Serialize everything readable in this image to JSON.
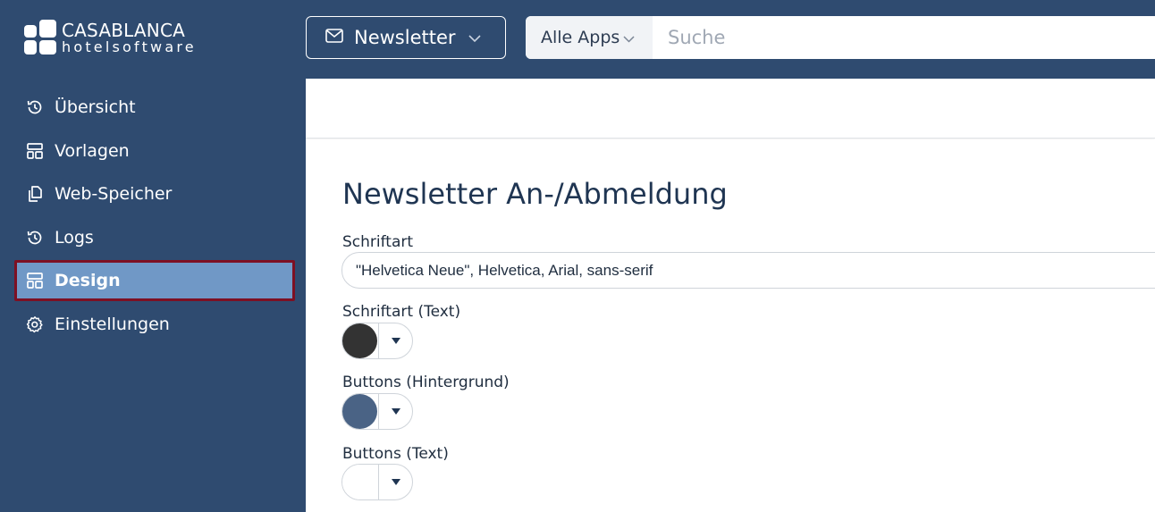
{
  "brand": {
    "name_line1": "CASABLANCA",
    "name_line2": "hotelsoftware",
    "colors": {
      "topbar": "#2f4b70",
      "sidebar": "#2f4b70",
      "active_item": "#7098c6",
      "active_outline": "#7d1023"
    }
  },
  "header": {
    "app_select": {
      "label": "Newsletter",
      "icon": "mail-icon"
    },
    "search": {
      "scope_label": "Alle Apps",
      "placeholder": "Suche",
      "value": ""
    }
  },
  "sidebar": {
    "items": [
      {
        "label": "Übersicht",
        "icon": "history-icon",
        "active": false
      },
      {
        "label": "Vorlagen",
        "icon": "layout-icon",
        "active": false
      },
      {
        "label": "Web-Speicher",
        "icon": "copy-icon",
        "active": false
      },
      {
        "label": "Logs",
        "icon": "history-icon",
        "active": false
      },
      {
        "label": "Design",
        "icon": "layout-icon",
        "active": true
      },
      {
        "label": "Einstellungen",
        "icon": "gear-icon",
        "active": false
      }
    ]
  },
  "main": {
    "title": "Newsletter An-/Abmeldung",
    "font_field": {
      "label": "Schriftart",
      "value": "\"Helvetica Neue\", Helvetica, Arial, sans-serif"
    },
    "color_fields": [
      {
        "label": "Schriftart (Text)",
        "color": "#333333"
      },
      {
        "label": "Buttons (Hintergrund)",
        "color": "#4a6385"
      },
      {
        "label": "Buttons (Text)",
        "color": "#ffffff"
      }
    ]
  }
}
